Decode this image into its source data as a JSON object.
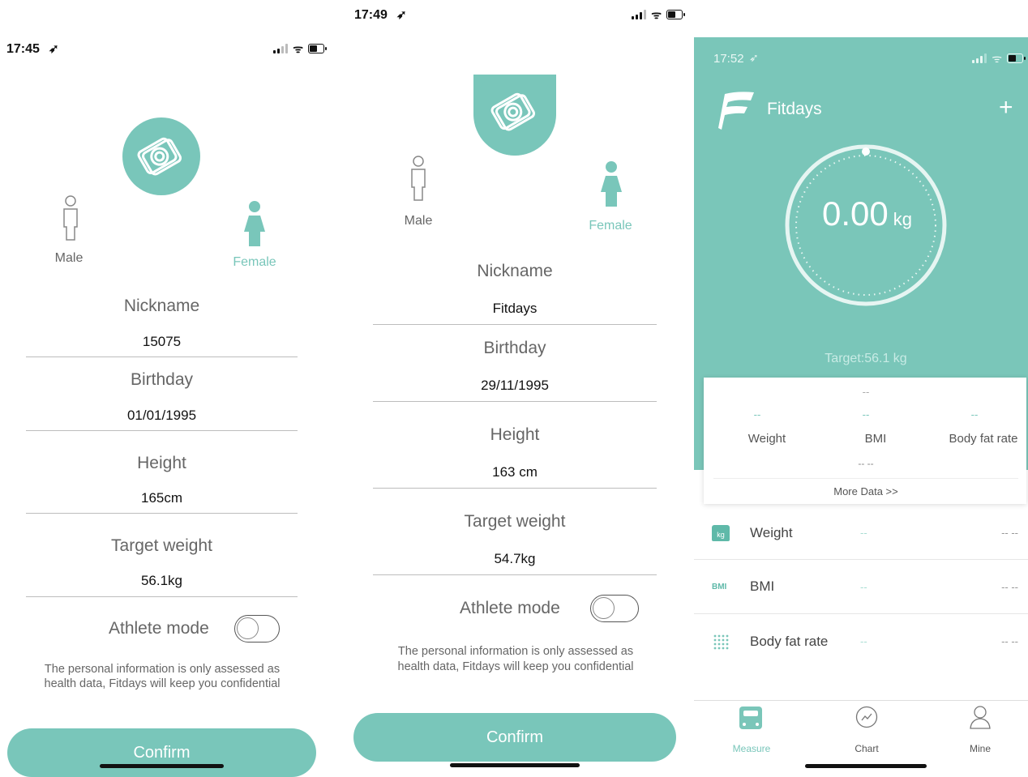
{
  "panel1": {
    "status_time": "17:45",
    "gender": {
      "male": "Male",
      "female": "Female"
    },
    "fields": [
      {
        "label": "Nickname",
        "value": "15075"
      },
      {
        "label": "Birthday",
        "value": "01/01/1995"
      },
      {
        "label": "Height",
        "value": "165cm"
      },
      {
        "label": "Target weight",
        "value": "56.1kg"
      }
    ],
    "athlete_label": "Athlete mode",
    "disclaimer_line1": "The personal information is only assessed as",
    "disclaimer_line2": "health data, Fitdays will keep you confidential",
    "confirm": "Confirm"
  },
  "panel2": {
    "status_time": "17:49",
    "gender": {
      "male": "Male",
      "female": "Female"
    },
    "fields": [
      {
        "label": "Nickname",
        "value": "Fitdays"
      },
      {
        "label": "Birthday",
        "value": "29/11/1995"
      },
      {
        "label": "Height",
        "value": "163 cm"
      },
      {
        "label": "Target weight",
        "value": "54.7kg"
      }
    ],
    "athlete_label": "Athlete mode",
    "disclaimer_line1": "The personal information is only assessed as",
    "disclaimer_line2": "health data, Fitdays will keep you confidential",
    "confirm": "Confirm"
  },
  "panel3": {
    "status_time": "17:52",
    "app_title": "Fitdays",
    "add_symbol": "+",
    "weight_value": "0.00",
    "weight_unit": "kg",
    "target": "Target:56.1 kg",
    "summary": {
      "top_dash": "--",
      "cols": [
        {
          "dash": "--",
          "label": "Weight"
        },
        {
          "dash": "--",
          "label": "BMI"
        },
        {
          "dash": "--",
          "label": "Body fat rate"
        }
      ],
      "bmi_sub": "-- --",
      "more": "More Data >>"
    },
    "rows": [
      {
        "icon_text": "kg",
        "label": "Weight",
        "mid": "--",
        "right": "-- --"
      },
      {
        "icon_text": "BMI",
        "label": "BMI",
        "mid": "--",
        "right": "-- --"
      },
      {
        "icon_text": "",
        "label": "Body fat rate",
        "mid": "--",
        "right": "-- --"
      }
    ],
    "tabs": [
      {
        "label": "Measure",
        "active": true
      },
      {
        "label": "Chart",
        "active": false
      },
      {
        "label": "Mine",
        "active": false
      }
    ]
  },
  "colors": {
    "accent": "#79c6ba",
    "header": "#7ac6b9"
  }
}
